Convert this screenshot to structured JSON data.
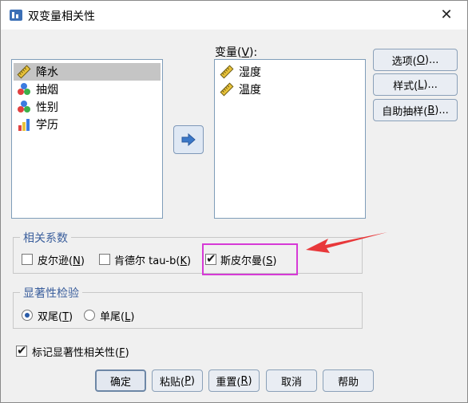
{
  "window": {
    "title": "双变量相关性",
    "close_glyph": "✕"
  },
  "source_list": {
    "items": [
      {
        "label": "降水",
        "icon": "scale-ruler-icon",
        "selected": true
      },
      {
        "label": "抽烟",
        "icon": "nominal-balls-icon",
        "selected": false
      },
      {
        "label": "性别",
        "icon": "nominal-balls-icon",
        "selected": false
      },
      {
        "label": "学历",
        "icon": "ordinal-bars-icon",
        "selected": false
      }
    ]
  },
  "variables": {
    "label": "变量(",
    "mnemonic": "V",
    "label_end": "):",
    "items": [
      {
        "label": "湿度",
        "icon": "scale-ruler-icon"
      },
      {
        "label": "温度",
        "icon": "scale-ruler-icon"
      }
    ]
  },
  "side_buttons": {
    "options": {
      "text": "选项(",
      "mnemonic": "O",
      "end": ")..."
    },
    "style": {
      "text": "样式(",
      "mnemonic": "L",
      "end": ")..."
    },
    "bootstrap": {
      "text": "自助抽样(",
      "mnemonic": "B",
      "end": ")..."
    }
  },
  "correlation": {
    "title": "相关系数",
    "pearson": {
      "text": "皮尔逊(",
      "mnemonic": "N",
      "end": ")",
      "checked": false
    },
    "kendall": {
      "text": "肯德尔 tau-b(",
      "mnemonic": "K",
      "end": ")",
      "checked": false
    },
    "spearman": {
      "text": "斯皮尔曼(",
      "mnemonic": "S",
      "end": ")",
      "checked": true
    }
  },
  "significance": {
    "title": "显著性检验",
    "two_tailed": {
      "text": "双尾(",
      "mnemonic": "T",
      "end": ")",
      "checked": true
    },
    "one_tailed": {
      "text": "单尾(",
      "mnemonic": "L",
      "end": ")",
      "checked": false
    }
  },
  "flag": {
    "text": "标记显著性相关性(",
    "mnemonic": "F",
    "end": ")",
    "checked": true
  },
  "bottom_buttons": {
    "ok": "确定",
    "paste": {
      "text": "粘贴(",
      "mnemonic": "P",
      "end": ")"
    },
    "reset": {
      "text": "重置(",
      "mnemonic": "R",
      "end": ")"
    },
    "cancel": "取消",
    "help": "帮助"
  },
  "colors": {
    "annotation_box": "#d63ad6",
    "annotation_arrow": "#e8383a",
    "group_title": "#3a5e9c"
  }
}
